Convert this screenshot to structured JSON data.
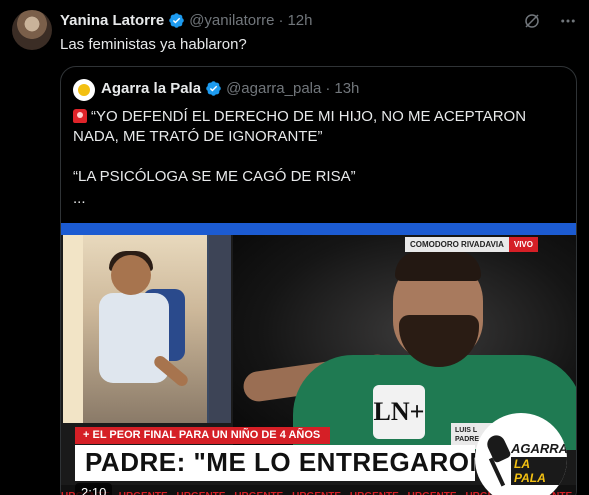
{
  "tweet": {
    "author_name": "Yanina Latorre",
    "author_handle": "@yanilatorre",
    "separator": "·",
    "time": "12h",
    "text": "Las feministas ya hablaron?"
  },
  "quote": {
    "author_name": "Agarra la Pala",
    "author_handle": "@agarra_pala",
    "separator": "·",
    "time": "13h",
    "line1": "“YO DEFENDÍ EL DERECHO DE MI HIJO, NO ME ACEPTARON NADA, ME TRATÓ DE IGNORANTE”",
    "line2": "“LA PSICÓLOGA SE ME CAGÓ DE RISA”",
    "line3": "..."
  },
  "video": {
    "location": "COMODORO RIVADAVIA",
    "live": "VIVO",
    "lower_third": "+ EL PEOR FINAL PARA UN NIÑO DE 4 AÑOS",
    "headline": "PADRE: \"ME LO ENTREGARON MUERT",
    "ticker": "URGENTE - URGENTE - URGENTE - URGENTE - URGENTE - URGENTE - URGENTE - URGENTE - URGENTE - URGENTE",
    "duration": "2:10",
    "name_card_line1": "LUIS L",
    "name_card_line2": "PADRE",
    "mic_logo": "LN+",
    "badge_line1": "AGARRÁ",
    "badge_line2": "LA PALA"
  },
  "colors": {
    "background": "#000000",
    "text_primary": "#e7e9ea",
    "text_secondary": "#71767b",
    "verified": "#1d9bf0",
    "border": "#2f3336",
    "news_red": "#d51f26",
    "news_blue": "#1c5bd1"
  }
}
